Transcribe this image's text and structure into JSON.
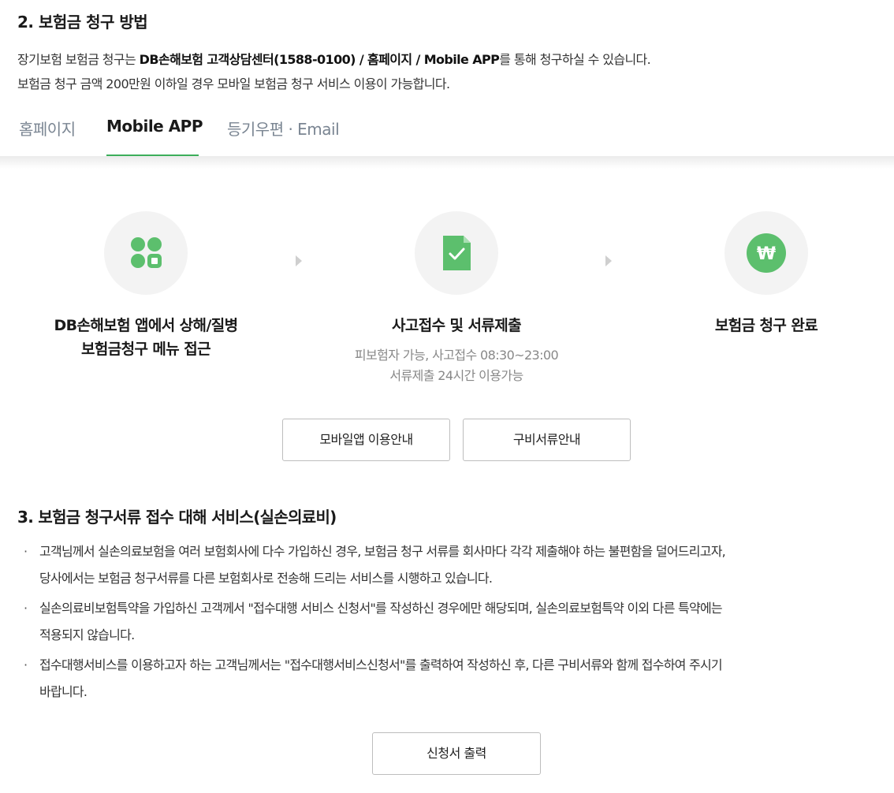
{
  "section2": {
    "title": "2. 보험금 청구 방법",
    "desc1_prefix": "장기보험 보험금 청구는 ",
    "desc1_bold": "DB손해보험 고객상담센터(1588-0100) / 홈페이지 / Mobile APP",
    "desc1_suffix": "를 통해 청구하실 수 있습니다.",
    "desc2": "보험금 청구 금액 200만원 이하일 경우 모바일 보험금 청구 서비스 이용이 가능합니다."
  },
  "tabs": [
    {
      "label": "홈페이지"
    },
    {
      "label": "Mobile APP"
    },
    {
      "label": "등기우편 · Email"
    }
  ],
  "steps": [
    {
      "icon": "app-grid-icon",
      "title_line1": "DB손해보험 앱에서 상해/질병",
      "title_line2": "보험금청구 메뉴 접근"
    },
    {
      "icon": "document-check-icon",
      "title_line1": "사고접수 및 서류제출",
      "sub_line1": "피보험자 가능, 사고접수 08:30~23:00",
      "sub_line2": "서류제출 24시간 이용가능"
    },
    {
      "icon": "won-icon",
      "title_line1": "보험금 청구 완료",
      "won_symbol": "₩"
    }
  ],
  "buttons": {
    "app_guide": "모바일앱 이용안내",
    "docs_guide": "구비서류안내",
    "print_form": "신청서 출력"
  },
  "section3": {
    "title": "3. 보험금 청구서류 접수 대해 서비스(실손의료비)",
    "bullets": [
      {
        "line1": "고객님께서 실손의료보험을 여러 보험회사에 다수 가입하신 경우, 보험금 청구 서류를 회사마다 각각 제출해야 하는 불편함을 덜어드리고자,",
        "line2": "당사에서는 보험금 청구서류를 다른 보험회사로 전송해 드리는 서비스를 시행하고 있습니다."
      },
      {
        "line1": "실손의료비보험특약을 가입하신 고객께서 \"접수대행 서비스 신청서\"를 작성하신 경우에만 해당되며, 실손의료보험특약 이외 다른 특약에는",
        "line2": "적용되지 않습니다."
      },
      {
        "line1": "접수대행서비스를 이용하고자 하는 고객님께서는 \"접수대행서비스신청서\"를 출력하여 작성하신 후, 다른 구비서류와 함께 접수하여 주시기",
        "line2": "바랍니다."
      }
    ],
    "bullet_mark": "·"
  },
  "colors": {
    "accent": "#3cae5a",
    "icon_green": "#5cbf6d",
    "circle_bg": "#f3f3f3"
  }
}
